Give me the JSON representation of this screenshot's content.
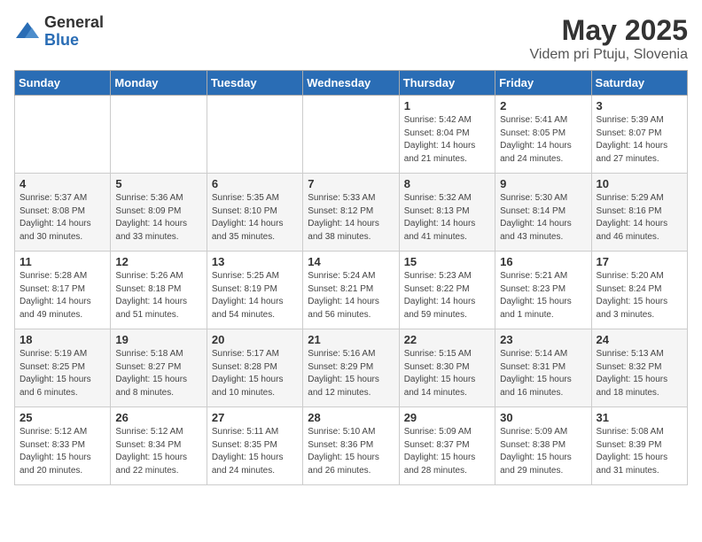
{
  "header": {
    "logo_general": "General",
    "logo_blue": "Blue",
    "month": "May 2025",
    "location": "Videm pri Ptuju, Slovenia"
  },
  "weekdays": [
    "Sunday",
    "Monday",
    "Tuesday",
    "Wednesday",
    "Thursday",
    "Friday",
    "Saturday"
  ],
  "weeks": [
    [
      {
        "day": "",
        "info": ""
      },
      {
        "day": "",
        "info": ""
      },
      {
        "day": "",
        "info": ""
      },
      {
        "day": "",
        "info": ""
      },
      {
        "day": "1",
        "info": "Sunrise: 5:42 AM\nSunset: 8:04 PM\nDaylight: 14 hours\nand 21 minutes."
      },
      {
        "day": "2",
        "info": "Sunrise: 5:41 AM\nSunset: 8:05 PM\nDaylight: 14 hours\nand 24 minutes."
      },
      {
        "day": "3",
        "info": "Sunrise: 5:39 AM\nSunset: 8:07 PM\nDaylight: 14 hours\nand 27 minutes."
      }
    ],
    [
      {
        "day": "4",
        "info": "Sunrise: 5:37 AM\nSunset: 8:08 PM\nDaylight: 14 hours\nand 30 minutes."
      },
      {
        "day": "5",
        "info": "Sunrise: 5:36 AM\nSunset: 8:09 PM\nDaylight: 14 hours\nand 33 minutes."
      },
      {
        "day": "6",
        "info": "Sunrise: 5:35 AM\nSunset: 8:10 PM\nDaylight: 14 hours\nand 35 minutes."
      },
      {
        "day": "7",
        "info": "Sunrise: 5:33 AM\nSunset: 8:12 PM\nDaylight: 14 hours\nand 38 minutes."
      },
      {
        "day": "8",
        "info": "Sunrise: 5:32 AM\nSunset: 8:13 PM\nDaylight: 14 hours\nand 41 minutes."
      },
      {
        "day": "9",
        "info": "Sunrise: 5:30 AM\nSunset: 8:14 PM\nDaylight: 14 hours\nand 43 minutes."
      },
      {
        "day": "10",
        "info": "Sunrise: 5:29 AM\nSunset: 8:16 PM\nDaylight: 14 hours\nand 46 minutes."
      }
    ],
    [
      {
        "day": "11",
        "info": "Sunrise: 5:28 AM\nSunset: 8:17 PM\nDaylight: 14 hours\nand 49 minutes."
      },
      {
        "day": "12",
        "info": "Sunrise: 5:26 AM\nSunset: 8:18 PM\nDaylight: 14 hours\nand 51 minutes."
      },
      {
        "day": "13",
        "info": "Sunrise: 5:25 AM\nSunset: 8:19 PM\nDaylight: 14 hours\nand 54 minutes."
      },
      {
        "day": "14",
        "info": "Sunrise: 5:24 AM\nSunset: 8:21 PM\nDaylight: 14 hours\nand 56 minutes."
      },
      {
        "day": "15",
        "info": "Sunrise: 5:23 AM\nSunset: 8:22 PM\nDaylight: 14 hours\nand 59 minutes."
      },
      {
        "day": "16",
        "info": "Sunrise: 5:21 AM\nSunset: 8:23 PM\nDaylight: 15 hours\nand 1 minute."
      },
      {
        "day": "17",
        "info": "Sunrise: 5:20 AM\nSunset: 8:24 PM\nDaylight: 15 hours\nand 3 minutes."
      }
    ],
    [
      {
        "day": "18",
        "info": "Sunrise: 5:19 AM\nSunset: 8:25 PM\nDaylight: 15 hours\nand 6 minutes."
      },
      {
        "day": "19",
        "info": "Sunrise: 5:18 AM\nSunset: 8:27 PM\nDaylight: 15 hours\nand 8 minutes."
      },
      {
        "day": "20",
        "info": "Sunrise: 5:17 AM\nSunset: 8:28 PM\nDaylight: 15 hours\nand 10 minutes."
      },
      {
        "day": "21",
        "info": "Sunrise: 5:16 AM\nSunset: 8:29 PM\nDaylight: 15 hours\nand 12 minutes."
      },
      {
        "day": "22",
        "info": "Sunrise: 5:15 AM\nSunset: 8:30 PM\nDaylight: 15 hours\nand 14 minutes."
      },
      {
        "day": "23",
        "info": "Sunrise: 5:14 AM\nSunset: 8:31 PM\nDaylight: 15 hours\nand 16 minutes."
      },
      {
        "day": "24",
        "info": "Sunrise: 5:13 AM\nSunset: 8:32 PM\nDaylight: 15 hours\nand 18 minutes."
      }
    ],
    [
      {
        "day": "25",
        "info": "Sunrise: 5:12 AM\nSunset: 8:33 PM\nDaylight: 15 hours\nand 20 minutes."
      },
      {
        "day": "26",
        "info": "Sunrise: 5:12 AM\nSunset: 8:34 PM\nDaylight: 15 hours\nand 22 minutes."
      },
      {
        "day": "27",
        "info": "Sunrise: 5:11 AM\nSunset: 8:35 PM\nDaylight: 15 hours\nand 24 minutes."
      },
      {
        "day": "28",
        "info": "Sunrise: 5:10 AM\nSunset: 8:36 PM\nDaylight: 15 hours\nand 26 minutes."
      },
      {
        "day": "29",
        "info": "Sunrise: 5:09 AM\nSunset: 8:37 PM\nDaylight: 15 hours\nand 28 minutes."
      },
      {
        "day": "30",
        "info": "Sunrise: 5:09 AM\nSunset: 8:38 PM\nDaylight: 15 hours\nand 29 minutes."
      },
      {
        "day": "31",
        "info": "Sunrise: 5:08 AM\nSunset: 8:39 PM\nDaylight: 15 hours\nand 31 minutes."
      }
    ]
  ]
}
